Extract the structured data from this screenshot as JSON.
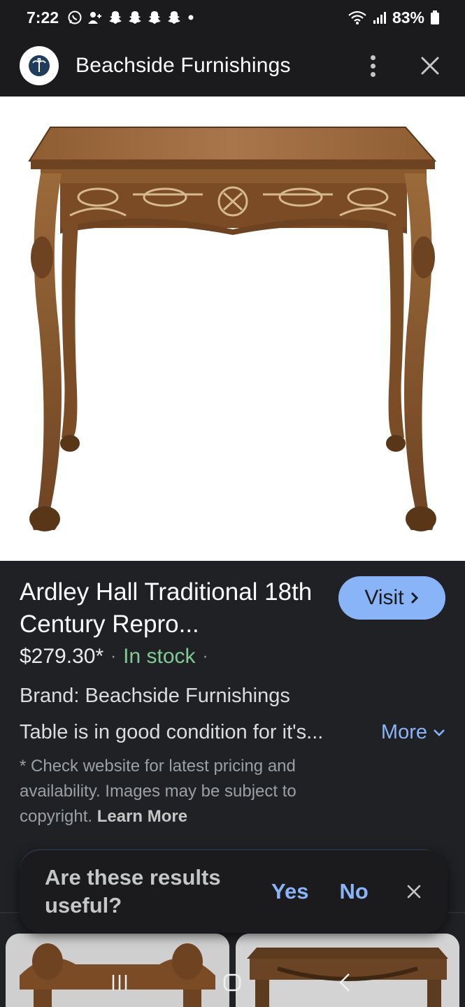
{
  "status_bar": {
    "time": "7:22",
    "battery": "83%"
  },
  "header": {
    "site_name": "Beachside Furnishings"
  },
  "product": {
    "title": "Ardley Hall Traditional 18th Century Repro...",
    "visit_label": "Visit",
    "price": "$279.30*",
    "stock": "In stock",
    "brand": "Brand: Beachside Furnishings",
    "description": "Table is in good condition for it's...",
    "more_label": "More",
    "disclaimer": "* Check website for latest pricing and availability. Images may be subject to copyright.",
    "learn_more_label": "Learn More"
  },
  "feedback": {
    "question": "Are these results useful?",
    "yes_label": "Yes",
    "no_label": "No"
  },
  "colors": {
    "accent_blue": "#8ab4f8",
    "stock_green": "#81c995",
    "background": "#202124",
    "wood": "#8a5a2e"
  },
  "icons": {
    "status_left": [
      "whatsapp-icon",
      "person-add-icon",
      "snapchat-icon",
      "snapchat-icon",
      "snapchat-icon",
      "snapchat-icon",
      "dot-icon"
    ],
    "status_right": [
      "wifi-icon",
      "signal-icon",
      "battery-icon"
    ]
  }
}
